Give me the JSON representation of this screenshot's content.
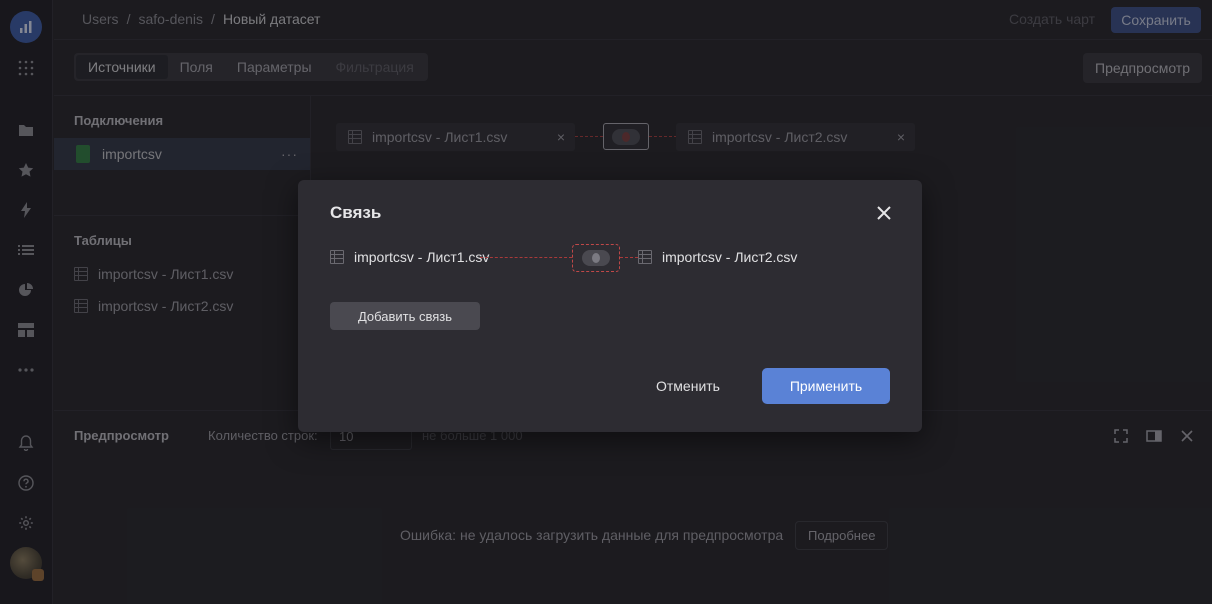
{
  "breadcrumbs": [
    "Users",
    "safo-denis",
    "Новый датасет"
  ],
  "breadcrumb_sep": "/",
  "topbar": {
    "create_chart": "Создать чарт",
    "save": "Сохранить"
  },
  "tabs": [
    {
      "label": "Источники",
      "state": "active"
    },
    {
      "label": "Поля",
      "state": "normal"
    },
    {
      "label": "Параметры",
      "state": "normal"
    },
    {
      "label": "Фильтрация",
      "state": "disabled"
    }
  ],
  "preview_button": "Предпросмотр",
  "left_panel": {
    "connections_title": "Подключения",
    "connection": {
      "label": "importcsv",
      "menu": "···"
    },
    "tables_title": "Таблицы",
    "tables": [
      "importcsv - Лист1.csv",
      "importcsv - Лист2.csv"
    ]
  },
  "canvas": {
    "left_source": "importcsv - Лист1.csv",
    "right_source": "importcsv - Лист2.csv",
    "remove": "×"
  },
  "preview_panel": {
    "title": "Предпросмотр",
    "rows_label": "Количество строк:",
    "rows_value": "10",
    "rows_hint": "не больше 1 000",
    "error": "Ошибка: не удалось загрузить данные для предпросмотра",
    "details": "Подробнее"
  },
  "modal": {
    "title": "Связь",
    "left_table": "importcsv - Лист1.csv",
    "right_table": "importcsv - Лист2.csv",
    "add_link": "Добавить связь",
    "cancel": "Отменить",
    "apply": "Применить"
  },
  "colors": {
    "accent": "#5a82d6",
    "link_line": "#c04848",
    "save": "#3a4d85"
  }
}
